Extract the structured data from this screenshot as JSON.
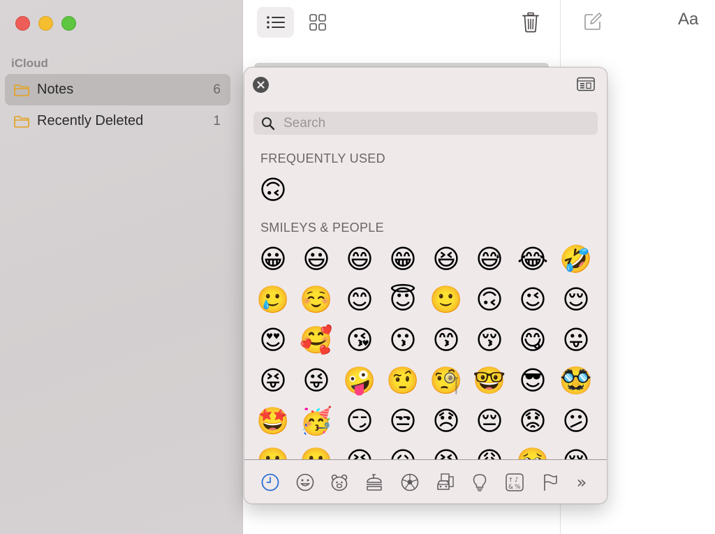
{
  "sidebar": {
    "section": "iCloud",
    "folders": [
      {
        "name": "Notes",
        "count": "6",
        "selected": true
      },
      {
        "name": "Recently Deleted",
        "count": "1",
        "selected": false
      }
    ]
  },
  "toolbar": {
    "format_label": "Aa"
  },
  "emoji_picker": {
    "search_placeholder": "Search",
    "frequently_used_label": "FREQUENTLY USED",
    "frequently_used": [
      "🙃"
    ],
    "smileys_label": "SMILEYS & PEOPLE",
    "smileys": [
      "😀",
      "😃",
      "😄",
      "😁",
      "😆",
      "😅",
      "😂",
      "🤣",
      "🥲",
      "☺️",
      "😊",
      "😇",
      "🙂",
      "🙃",
      "😉",
      "😌",
      "😍",
      "🥰",
      "😘",
      "😗",
      "😙",
      "😚",
      "😋",
      "😛",
      "😝",
      "😜",
      "🤪",
      "🤨",
      "🧐",
      "🤓",
      "😎",
      "🥸",
      "🤩",
      "🥳",
      "😏",
      "😒",
      "😞",
      "😔",
      "😟",
      "😕",
      "🙁",
      "☹️",
      "😣",
      "😖",
      "😫",
      "😩",
      "🥺",
      "😢"
    ],
    "category_tabs": [
      {
        "name": "recents",
        "selected": true
      },
      {
        "name": "smileys-people"
      },
      {
        "name": "animals-nature"
      },
      {
        "name": "food-drink"
      },
      {
        "name": "activity"
      },
      {
        "name": "travel-places"
      },
      {
        "name": "objects"
      },
      {
        "name": "symbols"
      },
      {
        "name": "flags"
      }
    ],
    "more_label": "»"
  },
  "colors": {
    "accent": "#2c6fd1",
    "folder_icon": "#e3a21a"
  }
}
